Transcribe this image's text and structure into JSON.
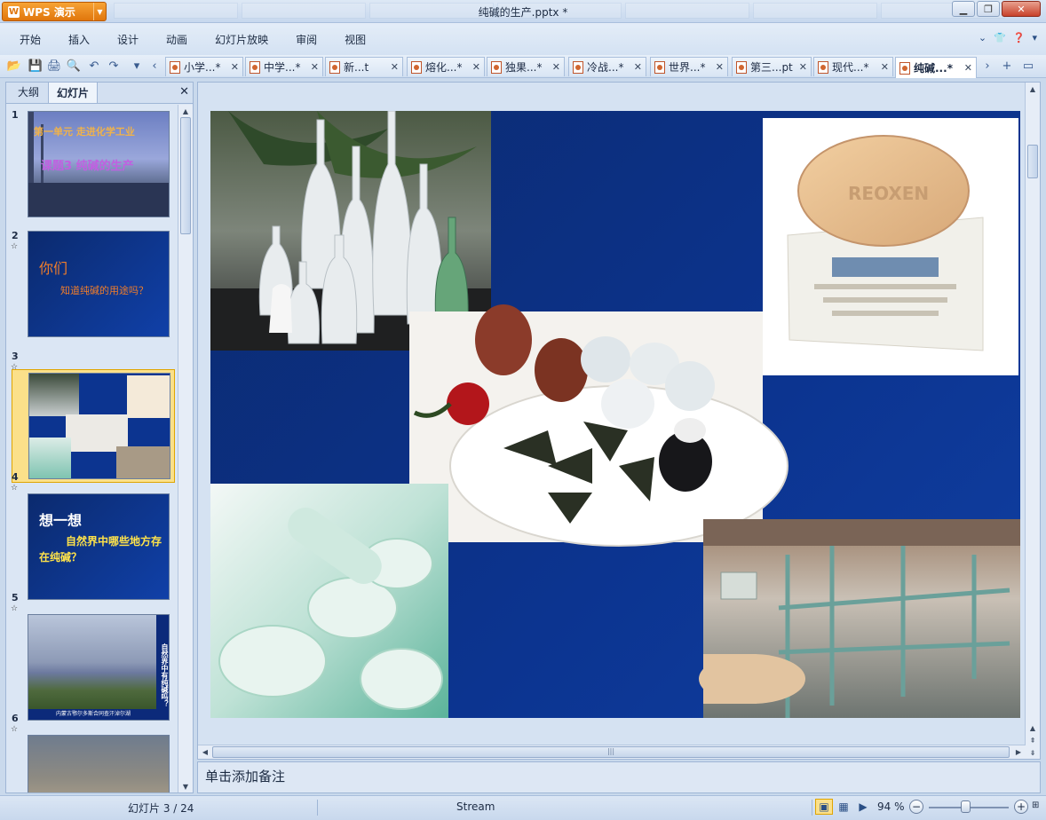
{
  "window": {
    "app_button": "WPS 演示",
    "title": "纯碱的生产.pptx *"
  },
  "menu": {
    "items": [
      "开始",
      "插入",
      "设计",
      "动画",
      "幻灯片放映",
      "审阅",
      "视图"
    ]
  },
  "doc_tabs": [
    {
      "label": "小学...",
      "modified": "*"
    },
    {
      "label": "中学...",
      "modified": "*"
    },
    {
      "label": "新...t",
      "modified": ""
    },
    {
      "label": "熔化...",
      "modified": "*"
    },
    {
      "label": "独果...",
      "modified": "*"
    },
    {
      "label": "冷战...",
      "modified": "*"
    },
    {
      "label": "世界...",
      "modified": "*"
    },
    {
      "label": "第三...pt",
      "modified": ""
    },
    {
      "label": "现代...",
      "modified": "*"
    },
    {
      "label": "纯碱...",
      "modified": "*"
    }
  ],
  "left_panel": {
    "tabs": [
      "大纲",
      "幻灯片"
    ],
    "active_tab": "幻灯片",
    "slides": [
      {
        "num": "1",
        "title_line1": "第一单元 走进化学工业",
        "title_line2": "课题3 纯碱的生产"
      },
      {
        "num": "2",
        "title_line1": "你们",
        "title_line2": "知道纯碱的用途吗？"
      },
      {
        "num": "3"
      },
      {
        "num": "4",
        "title_line1": "想一想",
        "title_line2": "自然界中哪些地方存在纯碱？"
      },
      {
        "num": "5",
        "side_text": "自然界中有纯碱吗？",
        "caption": "内蒙古鄂尔多斯合同查汗淖尔湖"
      },
      {
        "num": "6"
      }
    ],
    "selected": "3"
  },
  "notes": {
    "placeholder": "单击添加备注"
  },
  "status": {
    "slide_info": "幻灯片 3 / 24",
    "theme": "Stream",
    "zoom": "94 %"
  },
  "colors": {
    "slide_blue": "#0c3490",
    "accent_orange": "#e0760c",
    "selection": "#fbe08a"
  }
}
